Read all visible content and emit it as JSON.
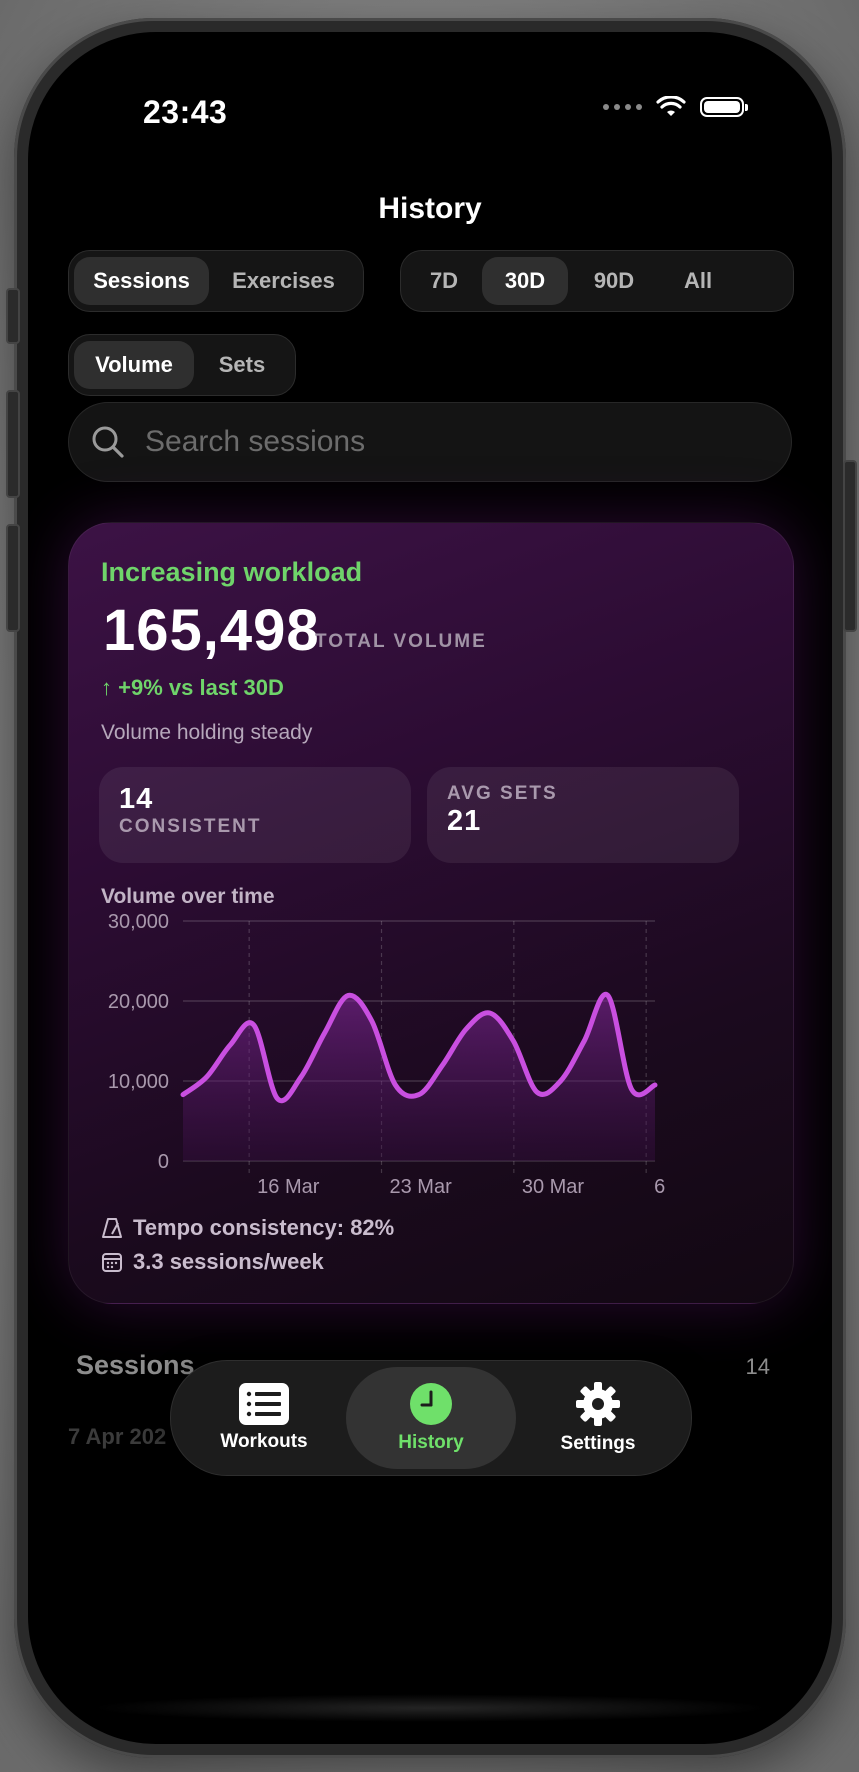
{
  "status": {
    "time": "23:43"
  },
  "header": {
    "title": "History"
  },
  "view_toggle": {
    "items": [
      {
        "label": "Sessions",
        "active": true
      },
      {
        "label": "Exercises",
        "active": false
      }
    ]
  },
  "range_toggle": {
    "items": [
      {
        "label": "7D",
        "active": false
      },
      {
        "label": "30D",
        "active": true
      },
      {
        "label": "90D",
        "active": false
      },
      {
        "label": "All",
        "active": false
      }
    ]
  },
  "metric_toggle": {
    "items": [
      {
        "label": "Volume",
        "active": true
      },
      {
        "label": "Sets",
        "active": false
      }
    ]
  },
  "search": {
    "placeholder": "Search sessions",
    "value": ""
  },
  "summary": {
    "trend_label": "Increasing workload",
    "total_value": "165,498",
    "total_unit": "TOTAL VOLUME",
    "delta": "↑ +9% vs last 30D",
    "subline": "Volume holding steady",
    "stats": [
      {
        "value": "14",
        "label": "CONSISTENT"
      },
      {
        "label": "AVG SETS",
        "value": "21"
      }
    ],
    "chart_title": "Volume over time",
    "tempo": "Tempo consistency: 82%",
    "frequency": "3.3 sessions/week",
    "accent_color": "#c94fe0",
    "positive_color": "#6fd46a"
  },
  "chart_data": {
    "type": "area",
    "title": "Volume over time",
    "x_labels": [
      "16 Mar",
      "23 Mar",
      "30 Mar",
      "6"
    ],
    "y_ticks": [
      "30,000",
      "20,000",
      "10,000",
      "0"
    ],
    "ylim": [
      0,
      30000
    ],
    "series": [
      {
        "values": [
          8300,
          10500,
          14500,
          17000,
          7800,
          10500,
          16000,
          20700,
          17500,
          9500,
          8300,
          12000,
          16500,
          18500,
          15000,
          8600,
          10000,
          15000,
          20700,
          9000,
          9500
        ]
      }
    ],
    "grid": true
  },
  "sessions": {
    "heading": "Sessions",
    "count": "14",
    "first_date": "7 Apr 202"
  },
  "tabbar": {
    "items": [
      {
        "label": "Workouts",
        "icon": "list-icon",
        "active": false
      },
      {
        "label": "History",
        "icon": "clock-icon",
        "active": true
      },
      {
        "label": "Settings",
        "icon": "gear-icon",
        "active": false
      }
    ]
  }
}
